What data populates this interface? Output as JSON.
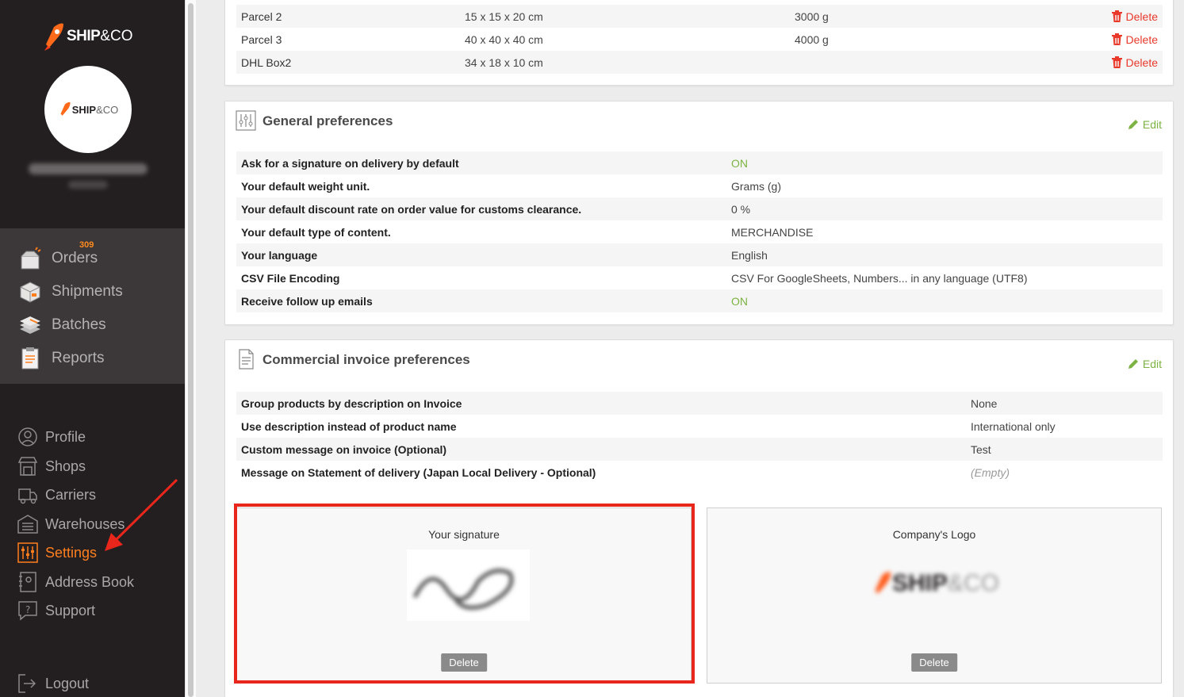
{
  "sidebar": {
    "brand": {
      "ship": "SHIP",
      "co": "&CO"
    },
    "orders_badge": "309",
    "main_items": [
      {
        "label": "Orders",
        "icon": "orders-box-icon"
      },
      {
        "label": "Shipments",
        "icon": "shipments-box-icon"
      },
      {
        "label": "Batches",
        "icon": "batches-stack-icon"
      },
      {
        "label": "Reports",
        "icon": "reports-clipboard-icon"
      }
    ],
    "sub_items": [
      {
        "label": "Profile",
        "icon": "profile-icon"
      },
      {
        "label": "Shops",
        "icon": "shops-icon"
      },
      {
        "label": "Carriers",
        "icon": "carriers-truck-icon"
      },
      {
        "label": "Warehouses",
        "icon": "warehouse-icon"
      },
      {
        "label": "Settings",
        "icon": "settings-sliders-icon"
      },
      {
        "label": "Address Book",
        "icon": "address-book-icon"
      },
      {
        "label": "Support",
        "icon": "support-icon"
      }
    ],
    "logout": "Logout"
  },
  "parcels": {
    "delete_label": "Delete",
    "rows": [
      {
        "name": "Parcel 2",
        "size": "15 x 15 x 20 cm",
        "weight": "3000 g"
      },
      {
        "name": "Parcel 3",
        "size": "40 x 40 x 40 cm",
        "weight": "4000 g"
      },
      {
        "name": "DHL Box2",
        "size": "34 x 18 x 10 cm",
        "weight": ""
      }
    ]
  },
  "general": {
    "title": "General preferences",
    "edit": "Edit",
    "rows": [
      {
        "label": "Ask for a signature on delivery by default",
        "value": "ON"
      },
      {
        "label": "Your default weight unit.",
        "value": "Grams (g)"
      },
      {
        "label": "Your default discount rate on order value for customs clearance.",
        "value": "0 %"
      },
      {
        "label": "Your default type of content.",
        "value": "MERCHANDISE"
      },
      {
        "label": "Your language",
        "value": "English"
      },
      {
        "label": "CSV File Encoding",
        "value": "CSV For GoogleSheets, Numbers... in any language (UTF8)"
      },
      {
        "label": "Receive follow up emails",
        "value": "ON"
      }
    ]
  },
  "invoice": {
    "title": "Commercial invoice preferences",
    "edit": "Edit",
    "rows": [
      {
        "label": "Group products by description on Invoice",
        "value": "None"
      },
      {
        "label": "Use description instead of product name",
        "value": "International only"
      },
      {
        "label": "Custom message on invoice (Optional)",
        "value": "Test"
      },
      {
        "label": "Message on Statement of delivery (Japan Local Delivery - Optional)",
        "value": "(Empty)"
      }
    ],
    "signature_caption": "Your signature",
    "logo_caption": "Company's Logo",
    "delete_button": "Delete"
  },
  "colors": {
    "accent": "#ff7f1e",
    "on": "#7cb342",
    "danger": "#e8392b",
    "sidebar": "#231f20"
  }
}
